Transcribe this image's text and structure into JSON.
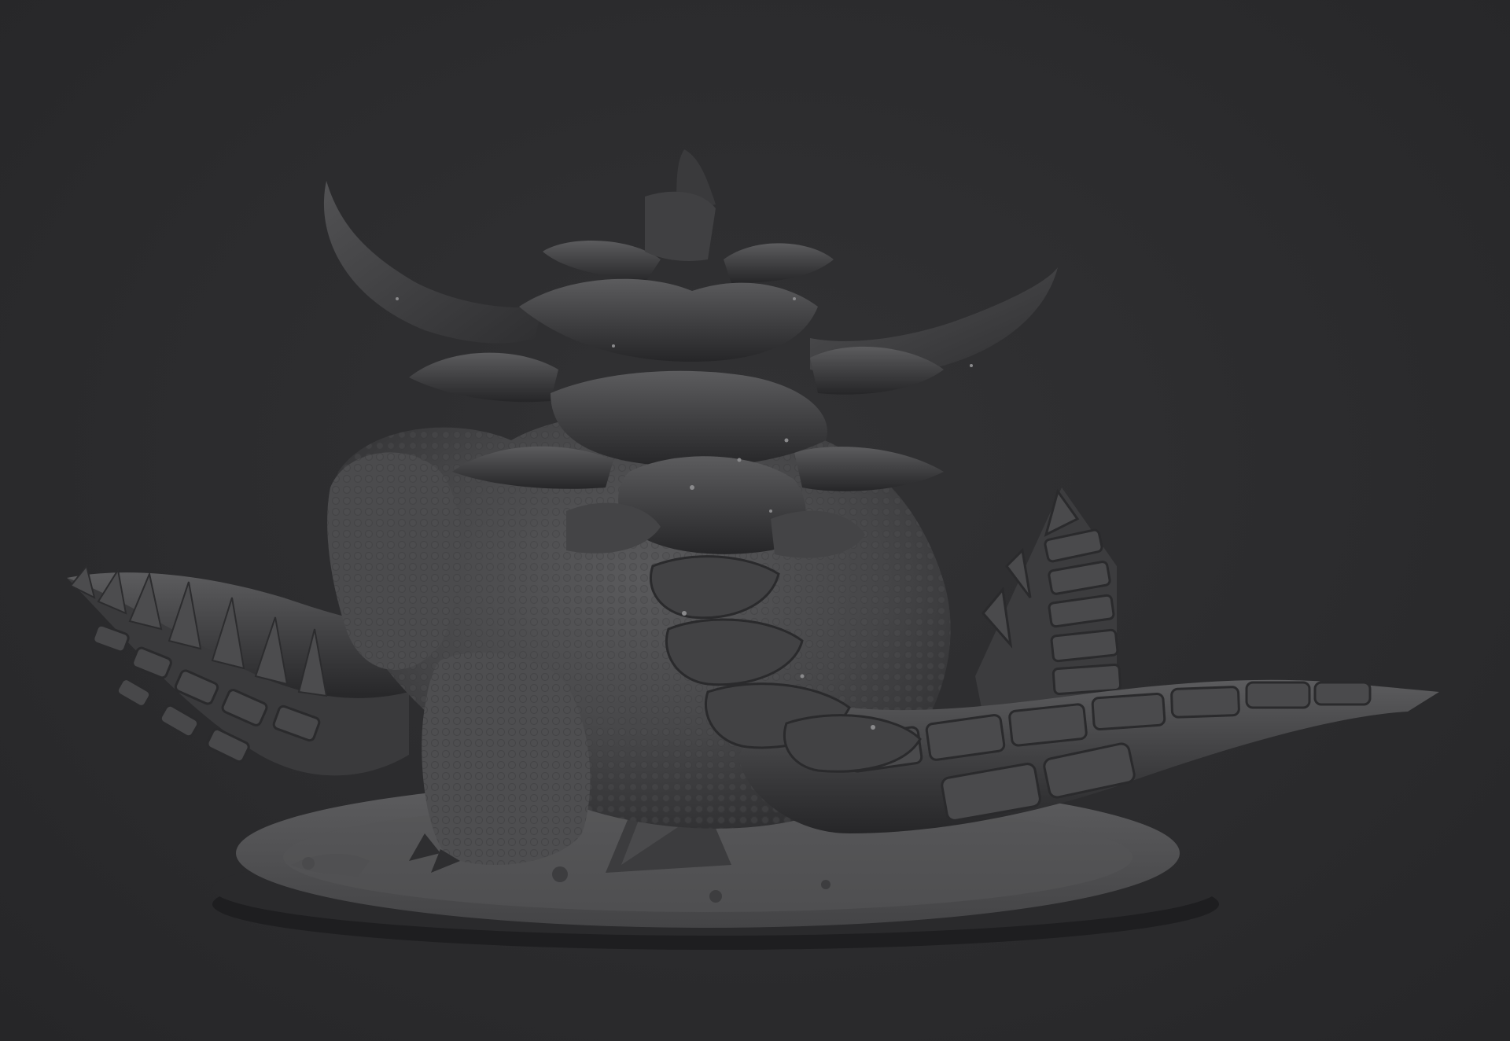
{
  "viewport": {
    "background": "#2b2b2d",
    "material_color": "#4a4a4c"
  },
  "subject": {
    "name_icon": "sculpted-creature-render",
    "parts": [
      "horns",
      "dorsal-plates",
      "spiked-tail-left",
      "spiked-tail-right",
      "body",
      "front-leg",
      "base"
    ]
  }
}
